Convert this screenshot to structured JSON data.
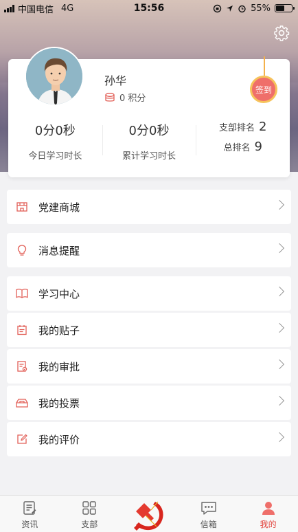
{
  "status_bar": {
    "carrier": "中国电信",
    "network": "4G",
    "time": "15:56",
    "battery": "55%",
    "battery_level": 0.55
  },
  "profile": {
    "name": "孙华",
    "points": "0 积分",
    "sign_in_label": "签到"
  },
  "stats": {
    "today": {
      "value": "0分0秒",
      "label": "今日学习时长"
    },
    "total": {
      "value": "0分0秒",
      "label": "累计学习时长"
    },
    "branch_rank_label": "支部排名",
    "branch_rank_value": "2",
    "overall_rank_label": "总排名",
    "overall_rank_value": "9"
  },
  "menu": {
    "shop": "党建商城",
    "reminders": "消息提醒",
    "study_center": "学习中心",
    "my_posts": "我的贴子",
    "my_approvals": "我的审批",
    "my_votes": "我的投票",
    "my_reviews": "我的评价"
  },
  "tabbar": {
    "news": "资讯",
    "branch": "支部",
    "mailbox": "信箱",
    "mine": "我的"
  },
  "colors": {
    "accent": "#e2463f",
    "sign_button": "#ef6f6a",
    "sign_ring": "#f6c35b"
  }
}
